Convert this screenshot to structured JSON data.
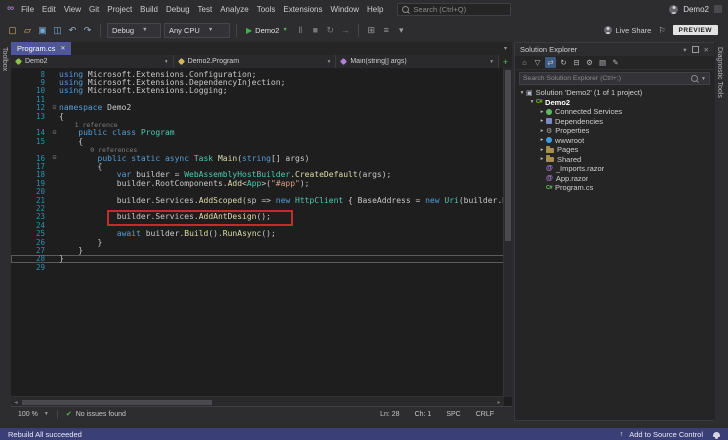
{
  "colors": {
    "accent_tab": "#4f5699",
    "status_bar": "#3b3f77",
    "annotation": "#c42b2b"
  },
  "titlebar": {
    "menus": [
      "File",
      "Edit",
      "View",
      "Git",
      "Project",
      "Build",
      "Debug",
      "Test",
      "Analyze",
      "Tools",
      "Extensions",
      "Window",
      "Help"
    ],
    "search_placeholder": "Search (Ctrl+Q)",
    "account_name": "Demo2"
  },
  "toolbar": {
    "left_icons": [
      {
        "name": "new-file-icon",
        "glyph": "▢",
        "color": "#d8b26a"
      },
      {
        "name": "open-folder-icon",
        "glyph": "▱",
        "color": "#d8b26a"
      },
      {
        "name": "save-icon",
        "glyph": "▣",
        "color": "#75a8d8"
      },
      {
        "name": "save-all-icon",
        "glyph": "◫",
        "color": "#75a8d8"
      },
      {
        "name": "undo-icon",
        "glyph": "↶",
        "color": "#9ab6d0"
      },
      {
        "name": "redo-icon",
        "glyph": "↷",
        "color": "#9ab6d0"
      }
    ],
    "config": "Debug",
    "platform": "Any CPU",
    "run_target": "Demo2",
    "debug_icons": [
      {
        "name": "pause-icon",
        "glyph": "Ⅱ",
        "color": "#777777"
      },
      {
        "name": "stop-icon",
        "glyph": "■",
        "color": "#777777"
      },
      {
        "name": "restart-icon",
        "glyph": "↻",
        "color": "#777777"
      },
      {
        "name": "show-next-statement-icon",
        "glyph": "→",
        "color": "#777777"
      }
    ],
    "extra_icons": [
      {
        "name": "step-into-icon",
        "glyph": "⊞",
        "color": "#9a9a9e"
      },
      {
        "name": "code-map-icon",
        "glyph": "≡",
        "color": "#9a9a9e"
      },
      {
        "name": "toolbar-options-icon",
        "glyph": "▾",
        "color": "#9a9a9e"
      }
    ],
    "live_share": "Live Share",
    "preview_badge": "PREVIEW"
  },
  "left_strip": {
    "label": "Toolbox"
  },
  "right_strip": {
    "label": "Diagnostic Tools"
  },
  "editor": {
    "tab_title": "Program.cs",
    "breadcrumbs": [
      "Demo2",
      "Demo2.Program",
      "Main(string[] args)"
    ],
    "code_lines": [
      {
        "num": "8",
        "parts": [
          [
            "kw",
            "using"
          ],
          [
            "pl",
            " Microsoft.Extensions.Configuration;"
          ]
        ]
      },
      {
        "num": "9",
        "parts": [
          [
            "kw",
            "using"
          ],
          [
            "pl",
            " Microsoft.Extensions.DependencyInjection;"
          ]
        ]
      },
      {
        "num": "10",
        "parts": [
          [
            "kw",
            "using"
          ],
          [
            "pl",
            " Microsoft.Extensions.Logging;"
          ]
        ]
      },
      {
        "num": "11",
        "parts": []
      },
      {
        "num": "12",
        "fold": true,
        "parts": [
          [
            "kw",
            "namespace"
          ],
          [
            "pl",
            " Demo2"
          ]
        ]
      },
      {
        "num": "13",
        "parts": [
          [
            "pl",
            "{"
          ]
        ]
      },
      {
        "lens": "    1 reference"
      },
      {
        "num": "14",
        "fold": true,
        "parts": [
          [
            "kw",
            "    public class "
          ],
          [
            "ty",
            "Program"
          ]
        ]
      },
      {
        "num": "15",
        "parts": [
          [
            "pl",
            "    {"
          ]
        ]
      },
      {
        "lens": "        0 references"
      },
      {
        "num": "16",
        "fold": true,
        "parts": [
          [
            "kw",
            "        public static async "
          ],
          [
            "ty",
            "Task"
          ],
          [
            "pl",
            " "
          ],
          [
            "me",
            "Main"
          ],
          [
            "pl",
            "("
          ],
          [
            "kw",
            "string"
          ],
          [
            "pl",
            "[] args)"
          ]
        ]
      },
      {
        "num": "17",
        "parts": [
          [
            "pl",
            "        {"
          ]
        ]
      },
      {
        "num": "18",
        "parts": [
          [
            "kw",
            "            var"
          ],
          [
            "pl",
            " builder = "
          ],
          [
            "ty",
            "WebAssemblyHostBuilder"
          ],
          [
            "pl",
            "."
          ],
          [
            "me",
            "CreateDefault"
          ],
          [
            "pl",
            "(args);"
          ]
        ]
      },
      {
        "num": "19",
        "parts": [
          [
            "pl",
            "            builder.RootComponents."
          ],
          [
            "me",
            "Add"
          ],
          [
            "pl",
            "<"
          ],
          [
            "ty",
            "App"
          ],
          [
            "pl",
            ">("
          ],
          [
            "st",
            "\"#app\""
          ],
          [
            "pl",
            ");"
          ]
        ]
      },
      {
        "num": "20",
        "parts": []
      },
      {
        "num": "21",
        "parts": [
          [
            "pl",
            "            builder.Services."
          ],
          [
            "me",
            "AddScoped"
          ],
          [
            "pl",
            "(sp => "
          ],
          [
            "kw",
            "new"
          ],
          [
            "pl",
            " "
          ],
          [
            "ty",
            "HttpClient"
          ],
          [
            "pl",
            " { BaseAddress = "
          ],
          [
            "kw",
            "new"
          ],
          [
            "pl",
            " "
          ],
          [
            "ty",
            "Uri"
          ],
          [
            "pl",
            "(builder.HostEnvironment.BaseAddress) });"
          ]
        ]
      },
      {
        "num": "22",
        "parts": []
      },
      {
        "num": "23",
        "redbox": true,
        "parts": [
          [
            "pl",
            "            builder.Services."
          ],
          [
            "me",
            "AddAntDesign"
          ],
          [
            "pl",
            "();"
          ]
        ]
      },
      {
        "num": "24",
        "parts": []
      },
      {
        "num": "25",
        "parts": [
          [
            "kw",
            "            await"
          ],
          [
            "pl",
            " builder."
          ],
          [
            "me",
            "Build"
          ],
          [
            "pl",
            "()."
          ],
          [
            "me",
            "RunAsync"
          ],
          [
            "pl",
            "();"
          ]
        ]
      },
      {
        "num": "26",
        "parts": [
          [
            "pl",
            "        }"
          ]
        ]
      },
      {
        "num": "27",
        "parts": [
          [
            "pl",
            "    }"
          ]
        ]
      },
      {
        "num": "28",
        "current": true,
        "parts": [
          [
            "pl",
            "}"
          ]
        ]
      },
      {
        "num": "29",
        "parts": []
      }
    ],
    "status": {
      "zoom": "100 %",
      "issues": "No issues found",
      "ln": "Ln: 28",
      "ch": "Ch: 1",
      "spc": "SPC",
      "eol": "CRLF"
    }
  },
  "solution_explorer": {
    "title": "Solution Explorer",
    "toolbar_icons": [
      {
        "name": "home-icon",
        "glyph": "⌂"
      },
      {
        "name": "filter-icon",
        "glyph": "▽"
      },
      {
        "name": "sync-with-active-document-icon",
        "glyph": "⇄",
        "active": true
      },
      {
        "name": "refresh-icon",
        "glyph": "↻"
      },
      {
        "name": "collapse-all-icon",
        "glyph": "⊟"
      },
      {
        "name": "properties-gear-icon",
        "glyph": "⚙"
      },
      {
        "name": "show-all-files-icon",
        "glyph": "▤"
      },
      {
        "name": "edit-icon",
        "glyph": "✎"
      }
    ],
    "search_placeholder": "Search Solution Explorer (Ctrl+;)",
    "tree": [
      {
        "label": "Solution 'Demo2' (1 of 1 project)",
        "icon": "solution",
        "indent": 0,
        "exp": "open"
      },
      {
        "label": "Demo2",
        "icon": "project",
        "indent": 1,
        "exp": "open",
        "bold": true
      },
      {
        "label": "Connected Services",
        "icon": "plug",
        "indent": 2,
        "exp": "closed"
      },
      {
        "label": "Dependencies",
        "icon": "dependencies",
        "indent": 2,
        "exp": "closed"
      },
      {
        "label": "Properties",
        "icon": "properties",
        "indent": 2,
        "exp": "closed"
      },
      {
        "label": "wwwroot",
        "icon": "globe",
        "indent": 2,
        "exp": "closed"
      },
      {
        "label": "Pages",
        "icon": "folder",
        "indent": 2,
        "exp": "closed"
      },
      {
        "label": "Shared",
        "icon": "folder",
        "indent": 2,
        "exp": "closed"
      },
      {
        "label": "_Imports.razor",
        "icon": "razor",
        "indent": 2,
        "exp": "none"
      },
      {
        "label": "App.razor",
        "icon": "razor",
        "indent": 2,
        "exp": "none"
      },
      {
        "label": "Program.cs",
        "icon": "csharp",
        "indent": 2,
        "exp": "none"
      }
    ]
  },
  "statusbar": {
    "left": "Rebuild All succeeded",
    "right": "Add to Source Control"
  }
}
